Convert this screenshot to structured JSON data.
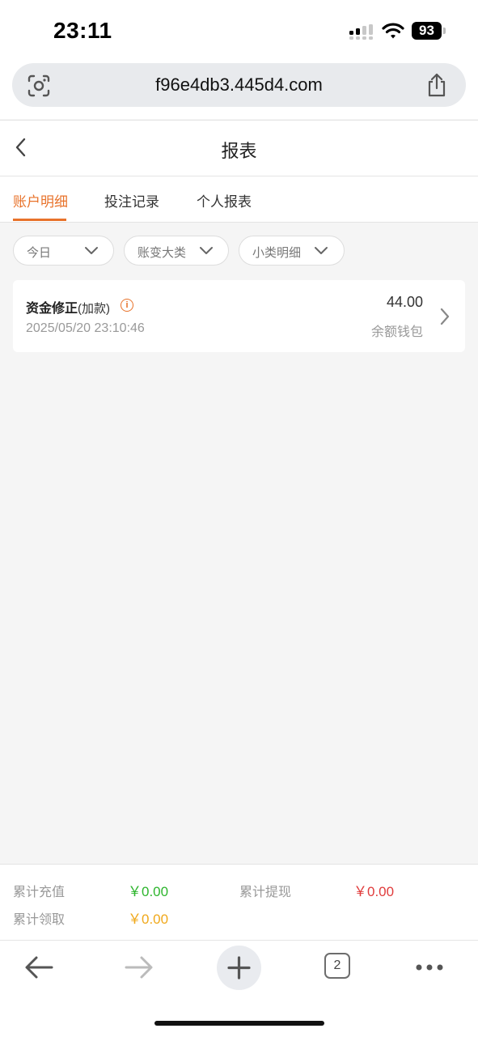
{
  "status": {
    "time": "23:11",
    "battery": "93"
  },
  "browser": {
    "url": "f96e4db3.445d4.com",
    "tab_count": "2"
  },
  "header": {
    "title": "报表"
  },
  "tabs": [
    {
      "label": "账户明细",
      "active": true
    },
    {
      "label": "投注记录",
      "active": false
    },
    {
      "label": "个人报表",
      "active": false
    }
  ],
  "filters": {
    "date": "今日",
    "category": "账变大类",
    "subcategory": "小类明细"
  },
  "records": [
    {
      "title": "资金修正",
      "subtitle": "(加款)",
      "time": "2025/05/20 23:10:46",
      "amount": "44.00",
      "wallet": "余额钱包"
    }
  ],
  "summary": {
    "recharge_label": "累计充值",
    "recharge_value": "￥0.00",
    "withdraw_label": "累计提现",
    "withdraw_value": "￥0.00",
    "claim_label": "累计领取",
    "claim_value": "￥0.00"
  },
  "colors": {
    "accent": "#e8722a",
    "green": "#2db52d",
    "red": "#e03b3b",
    "gold": "#f0a81a"
  },
  "icons": [
    "lens-icon",
    "share-icon",
    "back-arrow-icon",
    "chevron-down-icon",
    "info-icon",
    "chevron-right-icon",
    "browser-back-icon",
    "browser-forward-icon",
    "new-tab-icon",
    "more-icon"
  ]
}
